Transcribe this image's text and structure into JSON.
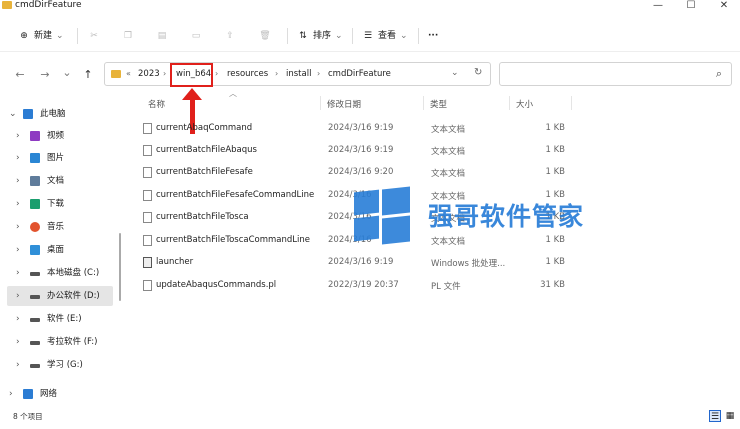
{
  "window": {
    "title": "cmdDirFeature",
    "controls": {
      "minimize": "—",
      "maximize": "☐",
      "close": "✕"
    }
  },
  "toolbar": {
    "new_label": "新建",
    "sort_label": "排序",
    "view_label": "查看",
    "more_label": "···"
  },
  "nav": {
    "back": "←",
    "forward": "→",
    "recent": "⌄",
    "up": "↑"
  },
  "address": {
    "overflow": "«",
    "crumbs": [
      "2023",
      "win_b64",
      "resources",
      "install",
      "cmdDirFeature"
    ],
    "separator": "›",
    "highlighted": "win_b64"
  },
  "search": {
    "placeholder": ""
  },
  "sidebar": {
    "items": [
      {
        "label": "此电脑",
        "icon": "computer-icon",
        "color": "#2b7cd3"
      },
      {
        "label": "视频",
        "icon": "video-icon",
        "color": "#8e3ac2"
      },
      {
        "label": "图片",
        "icon": "picture-icon",
        "color": "#2a86d4"
      },
      {
        "label": "文档",
        "icon": "document-icon",
        "color": "#5f7c9b"
      },
      {
        "label": "下载",
        "icon": "download-icon",
        "color": "#1a9e6e"
      },
      {
        "label": "音乐",
        "icon": "music-icon",
        "color": "#e2532d"
      },
      {
        "label": "桌面",
        "icon": "desktop-icon",
        "color": "#2f8fd8"
      },
      {
        "label": "本地磁盘 (C:)",
        "icon": "drive-c-icon",
        "color": "#555555"
      },
      {
        "label": "办公软件 (D:)",
        "icon": "drive-d-icon",
        "color": "#555555"
      },
      {
        "label": "软件 (E:)",
        "icon": "drive-e-icon",
        "color": "#555555"
      },
      {
        "label": "考拉软件 (F:)",
        "icon": "drive-f-icon",
        "color": "#555555"
      },
      {
        "label": "学习 (G:)",
        "icon": "drive-g-icon",
        "color": "#555555"
      },
      {
        "label": "网络",
        "icon": "network-icon",
        "color": "#2b7cd3"
      }
    ]
  },
  "columns": {
    "name": "名称",
    "date": "修改日期",
    "type": "类型",
    "size": "大小"
  },
  "files": [
    {
      "name": "currentAbaqCommand",
      "date": "2024/3/16 9:19",
      "type": "文本文档",
      "size": "1 KB"
    },
    {
      "name": "currentBatchFileAbaqus",
      "date": "2024/3/16 9:19",
      "type": "文本文档",
      "size": "1 KB"
    },
    {
      "name": "currentBatchFileFesafe",
      "date": "2024/3/16 9:20",
      "type": "文本文档",
      "size": "1 KB"
    },
    {
      "name": "currentBatchFileFesafeCommandLine",
      "date": "2024/3/16",
      "type": "文本文档",
      "size": "1 KB"
    },
    {
      "name": "currentBatchFileTosca",
      "date": "2024/3/16",
      "type": "文本文档",
      "size": "1 KB"
    },
    {
      "name": "currentBatchFileToscaCommandLine",
      "date": "2024/3/16",
      "type": "文本文档",
      "size": "1 KB"
    },
    {
      "name": "launcher",
      "date": "2024/3/16 9:19",
      "type": "Windows 批处理...",
      "size": "1 KB"
    },
    {
      "name": "updateAbaqusCommands.pl",
      "date": "2022/3/19 20:37",
      "type": "PL 文件",
      "size": "31 KB"
    }
  ],
  "status": {
    "count": "8 个项目"
  },
  "watermark": {
    "text": "强哥软件管家"
  },
  "colors": {
    "highlight": "#e0201b",
    "watermark": "#287dd7",
    "selected_bg": "#e5e5e5"
  }
}
